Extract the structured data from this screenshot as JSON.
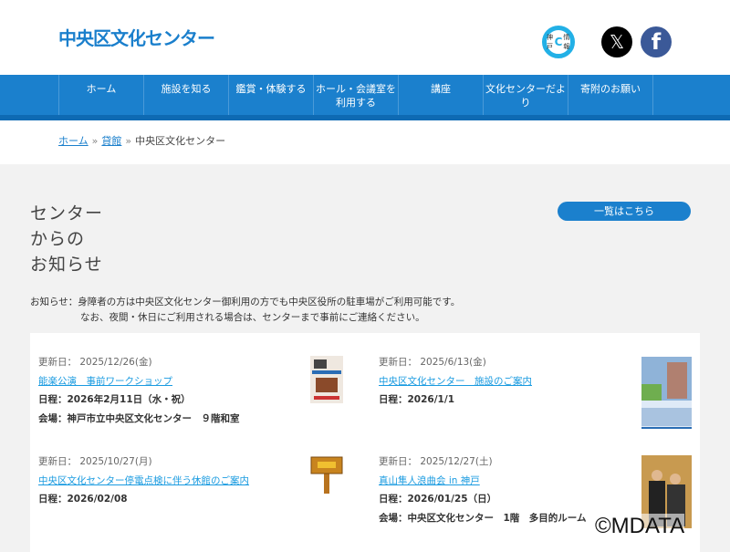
{
  "header": {
    "logo": "中央区文化センター",
    "kobe_badge": {
      "left": "神戸",
      "center": "C",
      "right": "情報"
    },
    "x_icon": "𝕏",
    "fb_icon": "f"
  },
  "nav": [
    "ホーム",
    "施設を知る",
    "鑑賞・体験する",
    "ホール・会議室を利用する",
    "講座",
    "文化センターだより",
    "寄附のお願い"
  ],
  "breadcrumb": {
    "home": "ホーム",
    "parent": "貸館",
    "current": "中央区文化センター",
    "sep": "»"
  },
  "section": {
    "title_lines": [
      "センター",
      "からの",
      "お知らせ"
    ],
    "list_button": "一覧はこちら"
  },
  "notice": {
    "line1": "お知らせ：身障者の方は中央区文化センター御利用の方でも中央区役所の駐車場がご利用可能です。",
    "line2": "なお、夜間・休日にご利用される場合は、センターまで事前にご連絡ください。"
  },
  "items": [
    {
      "date": "更新日： 2025/12/26(金)",
      "title": "能楽公演　事前ワークショップ",
      "schedule": "日程：2026年2月11日（水・祝）",
      "venue": "会場：神戸市立中央区文化センター　９階和室"
    },
    {
      "date": "更新日： 2025/6/13(金)",
      "title": "中央区文化センター　施設のご案内",
      "schedule": "日程：2026/1/1",
      "venue": ""
    },
    {
      "date": "更新日： 2025/10/27(月)",
      "title": "中央区文化センター停電点検に伴う休館のご案内",
      "schedule": "日程：2026/02/08",
      "venue": ""
    },
    {
      "date": "更新日： 2025/12/27(土)",
      "title": "真山隼人浪曲会 in 神戸",
      "schedule": "日程：2026/01/25（日）",
      "venue": "会場：中央区文化センター　1階　多目的ルーム"
    }
  ],
  "watermark": "©MDATA"
}
